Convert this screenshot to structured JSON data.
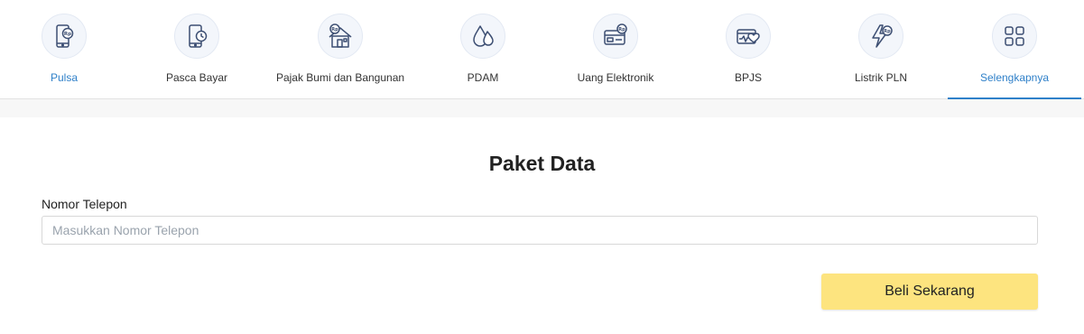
{
  "nav": {
    "items": [
      {
        "label": "Pulsa",
        "icon": "phone-rp-icon"
      },
      {
        "label": "Pasca Bayar",
        "icon": "phone-clock-icon"
      },
      {
        "label": "Pajak Bumi dan Bangunan",
        "icon": "house-rp-icon"
      },
      {
        "label": "PDAM",
        "icon": "water-drops-icon"
      },
      {
        "label": "Uang Elektronik",
        "icon": "card-rp-icon"
      },
      {
        "label": "BPJS",
        "icon": "health-card-icon"
      },
      {
        "label": "Listrik PLN",
        "icon": "lightning-rp-icon"
      },
      {
        "label": "Selengkapnya",
        "icon": "grid-icon"
      }
    ],
    "active_index": 7
  },
  "form": {
    "title": "Paket Data",
    "phone_label": "Nomor Telepon",
    "phone_value": "",
    "phone_placeholder": "Masukkan Nomor Telepon",
    "submit_label": "Beli Sekarang"
  },
  "colors": {
    "accent": "#2f80c9",
    "icon_stroke": "#3d4f73",
    "button": "#fde47f"
  }
}
